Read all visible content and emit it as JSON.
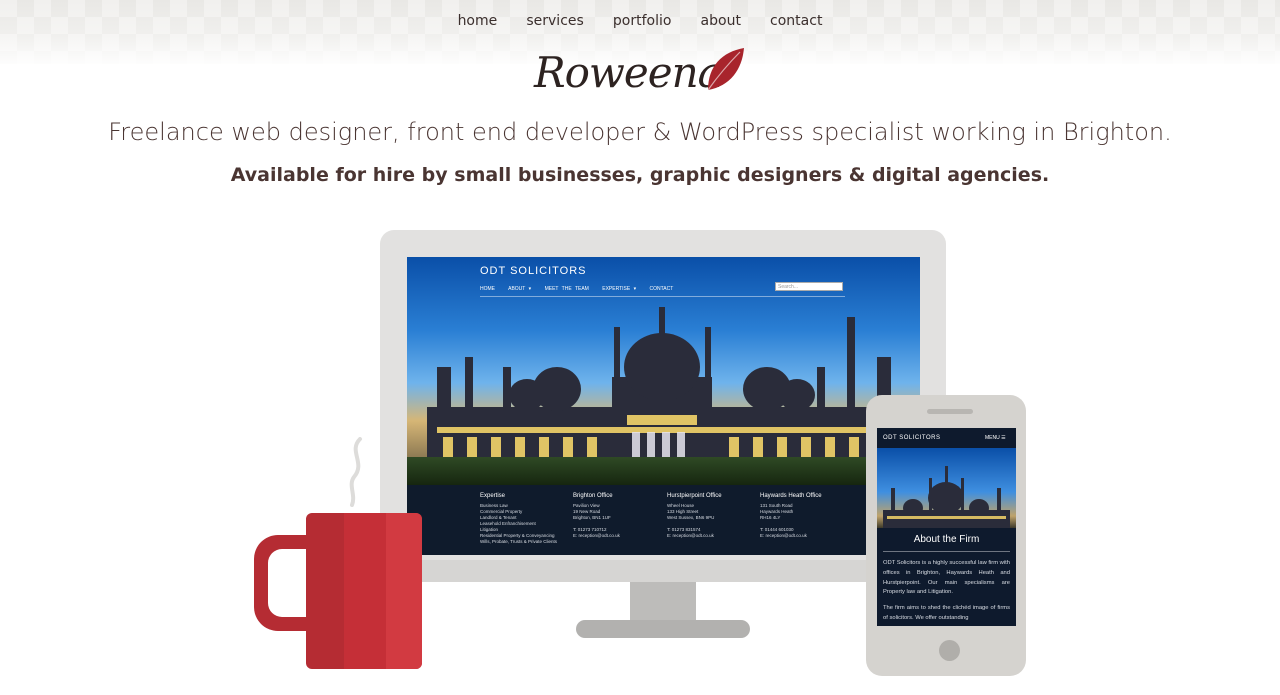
{
  "nav": {
    "items": [
      {
        "label": "home"
      },
      {
        "label": "services"
      },
      {
        "label": "portfolio"
      },
      {
        "label": "about"
      },
      {
        "label": "contact"
      }
    ]
  },
  "logo": {
    "text": "Roweena",
    "accent_color": "#a8242c"
  },
  "hero": {
    "headline": "Freelance web designer, front end developer & WordPress specialist working in Brighton.",
    "subheadline": "Available for hire by small businesses, graphic designers & digital agencies."
  },
  "desktop_preview": {
    "site_title": "ODT SOLICITORS",
    "nav": [
      "HOME",
      "ABOUT ▾",
      "MEET THE TEAM",
      "EXPERTISE ▾",
      "CONTACT"
    ],
    "search_placeholder": "Search...",
    "footer_columns": [
      {
        "heading": "Expertise",
        "lines": [
          "Business Law",
          "Commercial Property",
          "Landlord & Tenant",
          "Leasehold Enfranchisement",
          "Litigation",
          "Residential Property & Conveyancing",
          "Wills, Probate, Trusts & Private Clients"
        ]
      },
      {
        "heading": "Brighton Office",
        "lines": [
          "Pavilion View",
          "19 New Road",
          "Brighton, BN1 1UF",
          "",
          "T: 01273 710712",
          "E: reception@odt.co.uk"
        ]
      },
      {
        "heading": "Hurstpierpoint Office",
        "lines": [
          "Wheel House",
          "133 High Street",
          "West Sussex, BN6 9PU",
          "",
          "T: 01273 831574",
          "E: reception@odt.co.uk"
        ]
      },
      {
        "heading": "Haywards Heath Office",
        "lines": [
          "131 South Road",
          "Haywards Heath",
          "RH16 4LY",
          "",
          "T: 01444 601030",
          "E: reception@odt.co.uk"
        ]
      }
    ]
  },
  "mobile_preview": {
    "site_title": "ODT SOLICITORS",
    "menu_label": "MENU ☰",
    "heading": "About the Firm",
    "paragraph_1": "ODT Solicitors is a highly successful law firm with offices in Brighton, Haywards Heath and Hurstpierpoint. Our main specialisms are Property law and Litigation.",
    "paragraph_2": "The firm aims to shed the clichéd image of firms of solicitors. We offer outstanding"
  },
  "colors": {
    "text_primary": "#4a3532",
    "nav_text": "#3b2f2d",
    "mug_red": "#c52f37",
    "device_grey": "#e2e1e0",
    "phone_grey": "#d5d3cf"
  }
}
